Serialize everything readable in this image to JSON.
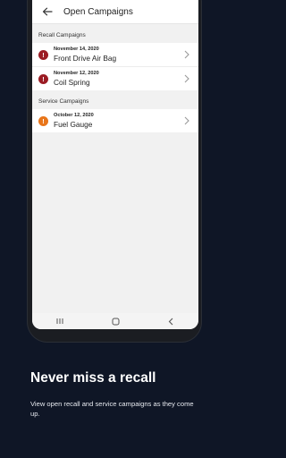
{
  "app": {
    "title": "Open Campaigns"
  },
  "sections": [
    {
      "header": "Recall Campaigns",
      "items": [
        {
          "date": "November 14, 2020",
          "name": "Front Drive Air Bag",
          "badge": "!"
        },
        {
          "date": "November 12, 2020",
          "name": "Coil Spring",
          "badge": "!"
        }
      ]
    },
    {
      "header": "Service Campaigns",
      "items": [
        {
          "date": "October 12, 2020",
          "name": "Fuel Gauge",
          "badge": "!"
        }
      ]
    }
  ],
  "promo": {
    "headline": "Never miss a recall",
    "subtext": "View open recall and service campaigns as they come up."
  },
  "colors": {
    "background": "#0f1626",
    "recall_badge": "#9b1c24",
    "service_badge": "#e8751a"
  },
  "icons": {
    "back": "back-arrow-icon",
    "chevron": "chevron-right-icon",
    "alert": "alert-icon",
    "nav_recents": "recents-icon",
    "nav_home": "home-icon",
    "nav_back": "nav-back-icon"
  }
}
